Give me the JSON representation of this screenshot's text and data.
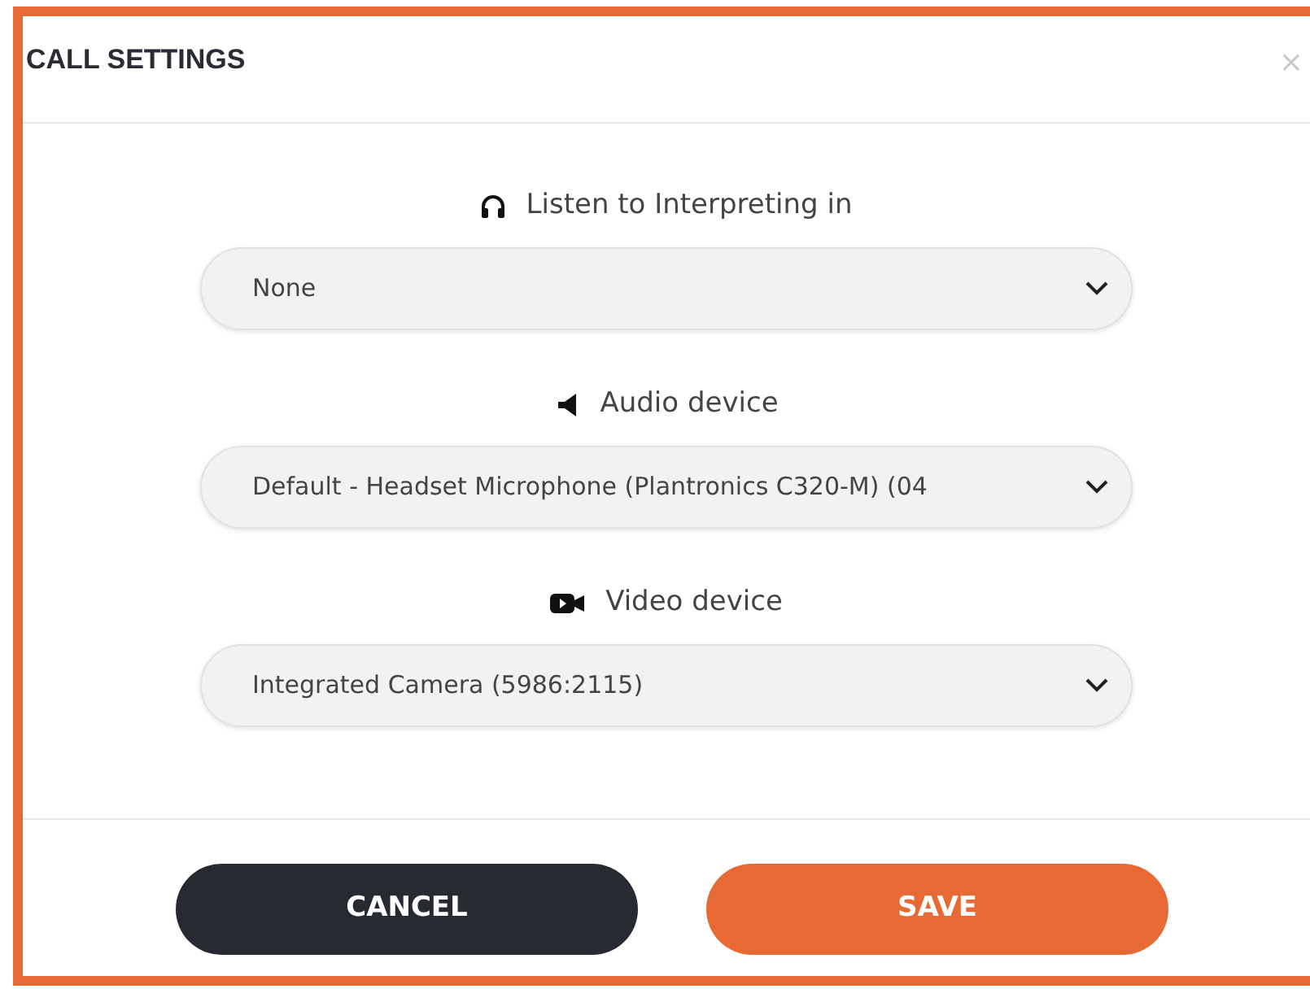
{
  "dialog": {
    "title": "CALL SETTINGS",
    "close": "×"
  },
  "fields": [
    {
      "kind": "headphones",
      "label": "Listen to Interpreting in",
      "value": "None"
    },
    {
      "kind": "speaker",
      "label": "Audio device",
      "value": "Default - Headset Microphone (Plantronics C320-M) (04"
    },
    {
      "kind": "camera",
      "label": "Video device",
      "value": "Integrated Camera (5986:2115)"
    }
  ],
  "buttons": [
    {
      "kind": "secondary",
      "label": "CANCEL"
    },
    {
      "kind": "primary",
      "label": "SAVE"
    }
  ]
}
